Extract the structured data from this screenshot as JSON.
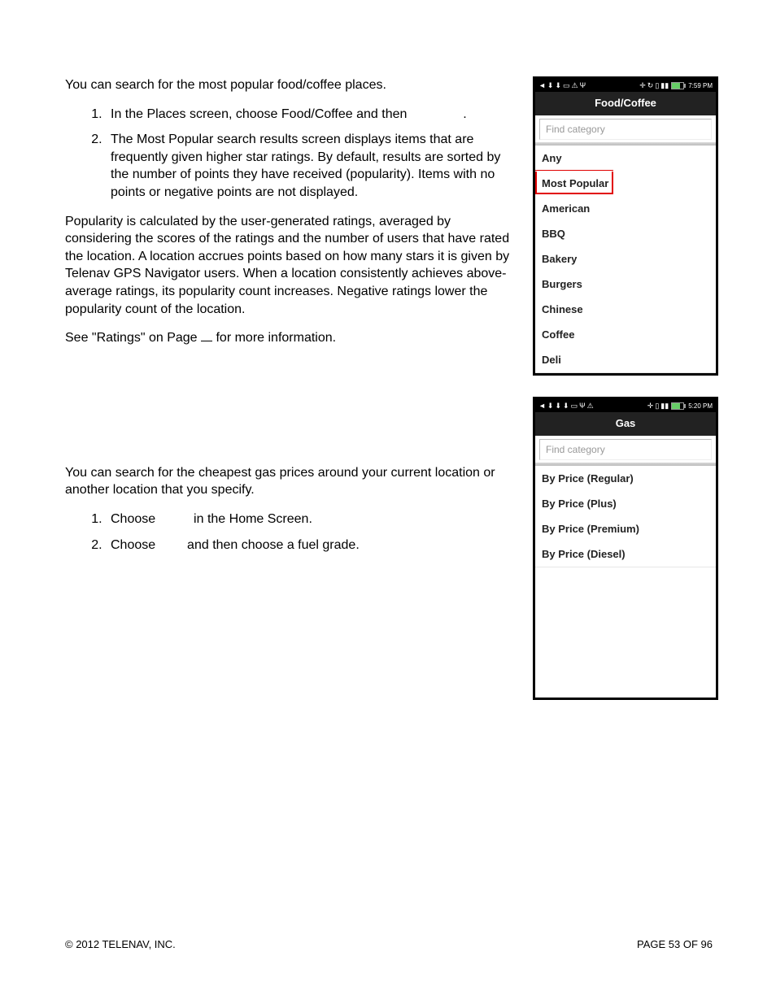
{
  "body": {
    "para1": "You can search for the most popular food/coffee places.",
    "list1": {
      "item1_pre": "In the Places screen, choose Food/Coffee and then ",
      "item1_post": ".",
      "item2": "The Most Popular search results screen displays items that are frequently given higher star ratings. By default, results are sorted by the number of points they have received (popularity). Items with no points or negative points are not displayed."
    },
    "para2": "Popularity is calculated by the user-generated ratings, averaged by considering the scores of the ratings and the number of users that have rated the location. A location accrues points based on how many stars it is given by Telenav GPS Navigator users. When a location consistently achieves above-average ratings, its popularity count increases. Negative ratings lower the popularity count of the location.",
    "para3_pre": "See \"Ratings\" on Page ",
    "para3_post": " for more information.",
    "para4": "You can search for the cheapest gas prices around your current location or another location that you specify.",
    "list2": {
      "item1_pre": "Choose ",
      "item1_post": " in the Home Screen.",
      "item2_pre": "Choose ",
      "item2_post": " and then choose a fuel grade."
    }
  },
  "phone1": {
    "time": "7:59 PM",
    "title": "Food/Coffee",
    "placeholder": "Find category",
    "items": [
      "Any",
      "Most Popular",
      "American",
      "BBQ",
      "Bakery",
      "Burgers",
      "Chinese",
      "Coffee",
      "Deli"
    ],
    "highlight_index": 1
  },
  "phone2": {
    "time": "5:20 PM",
    "title": "Gas",
    "placeholder": "Find category",
    "items": [
      "By Price (Regular)",
      "By Price (Plus)",
      "By Price (Premium)",
      "By Price (Diesel)"
    ]
  },
  "footer": {
    "left": "© 2012 TELENAV, INC.",
    "right": "PAGE 53 OF 96"
  }
}
